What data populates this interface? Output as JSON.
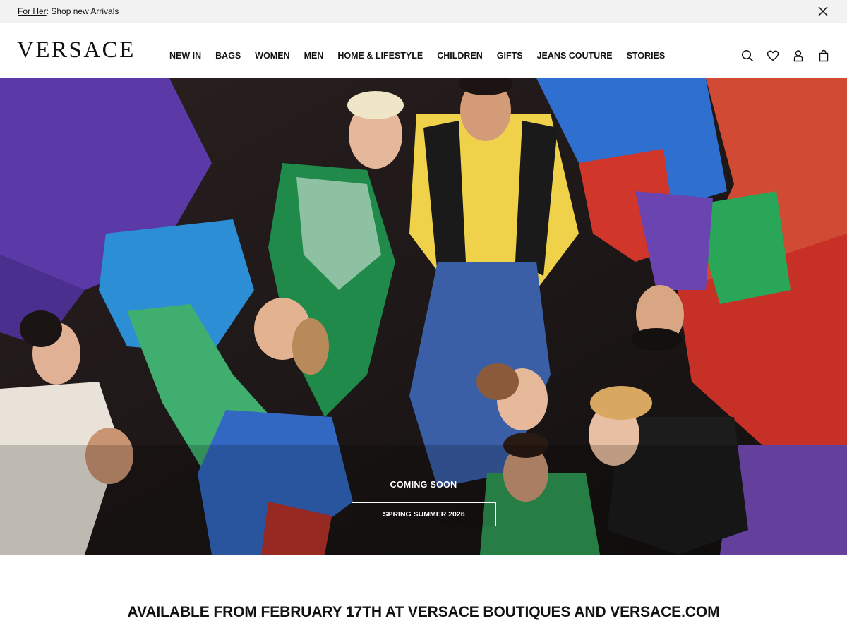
{
  "promo": {
    "link_text": "For Her",
    "text": ": Shop new Arrivals",
    "close_icon": "close-icon"
  },
  "header": {
    "logo": "VERSACE",
    "nav": [
      "NEW IN",
      "BAGS",
      "WOMEN",
      "MEN",
      "HOME & LIFESTYLE",
      "CHILDREN",
      "GIFTS",
      "JEANS COUTURE",
      "STORIES"
    ],
    "icons": [
      "search-icon",
      "heart-icon",
      "user-icon",
      "shopping-bag-icon"
    ]
  },
  "hero": {
    "kicker": "COMING SOON",
    "cta": "SPRING SUMMER 2026"
  },
  "headline": "AVAILABLE FROM FEBRUARY 17TH AT VERSACE BOUTIQUES AND VERSACE.COM",
  "colors": {
    "promo_bg": "#f2f2f2",
    "text": "#111111",
    "hero_bg": "#1a1616"
  }
}
